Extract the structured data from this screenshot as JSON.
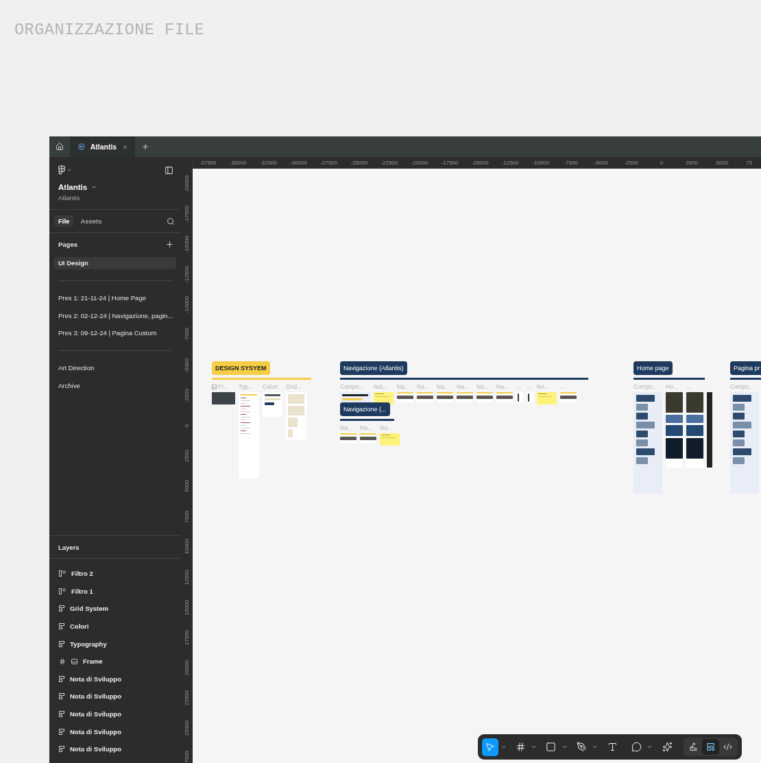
{
  "page_title": "ORGANIZZAZIONE FILE",
  "tabs": [
    {
      "label": "Atlantis",
      "selected": true
    }
  ],
  "sidebar": {
    "file_name": "Atlantis",
    "project": "Atlantis",
    "panel_tabs": [
      {
        "label": "File",
        "selected": true
      },
      {
        "label": "Assets",
        "selected": false
      }
    ],
    "pages_heading": "Pages",
    "page_groups": [
      {
        "items": [
          {
            "label": "UI Design",
            "selected": true
          }
        ]
      },
      {
        "items": [
          {
            "label": "Pres 1: 21-11-24 | Home Page",
            "selected": false
          },
          {
            "label": "Pres 2: 02-12-24 | Navigazione, pagin...",
            "selected": false
          },
          {
            "label": "Pres 3: 09-12-24 | Pagina Custom",
            "selected": false
          }
        ]
      },
      {
        "items": [
          {
            "label": "Art Direction",
            "selected": false
          },
          {
            "label": "Archive",
            "selected": false
          }
        ]
      }
    ],
    "layers_heading": "Layers",
    "layers": [
      {
        "name": "Filtro 2",
        "kind": "filter"
      },
      {
        "name": "Filtro 1",
        "kind": "filter"
      },
      {
        "name": "Grid System",
        "kind": "section"
      },
      {
        "name": "Colori",
        "kind": "section"
      },
      {
        "name": "Typography",
        "kind": "section"
      },
      {
        "name": "Frame",
        "kind": "frame"
      },
      {
        "name": "Nota di Sviluppo",
        "kind": "section"
      },
      {
        "name": "Nota di Sviluppo",
        "kind": "section"
      },
      {
        "name": "Nota di Sviluppo",
        "kind": "section"
      },
      {
        "name": "Nota di Sviluppo",
        "kind": "section"
      },
      {
        "name": "Nota di Sviluppo",
        "kind": "section"
      }
    ]
  },
  "rulers": {
    "horizontal": [
      "-37500",
      "-35000",
      "-32500",
      "-30000",
      "-27500",
      "-25000",
      "-22500",
      "-20000",
      "-17500",
      "-15000",
      "-12500",
      "-10000",
      "-7500",
      "-5000",
      "-2500",
      "0",
      "2500",
      "5000",
      "75"
    ],
    "vertical": [
      "-20000",
      "-17500",
      "-15000",
      "-12500",
      "-10000",
      "-7500",
      "-5000",
      "-2500",
      "0",
      "2500",
      "5000",
      "7500",
      "10000",
      "12500",
      "15000",
      "17500",
      "20000",
      "22500",
      "25000",
      "7500"
    ]
  },
  "canvas": {
    "sections": [
      {
        "label": "DESIGN SYSYEM",
        "color": "#f5cd47",
        "frames": [
          {
            "title": "Fr...",
            "kind": "photo"
          },
          {
            "title": "Typ...",
            "kind": "doc"
          },
          {
            "title": "Colori",
            "kind": "swatches"
          },
          {
            "title": "Grid...",
            "kind": "grid"
          }
        ]
      },
      {
        "label": "Navigazione (Atlantis)",
        "color": "#1e3a5f",
        "frames": [
          {
            "title": "Compo...",
            "kind": "component"
          },
          {
            "title": "Not...",
            "kind": "note"
          },
          {
            "title": "Na...",
            "kind": "screen"
          },
          {
            "title": "Na...",
            "kind": "screen"
          },
          {
            "title": "Na...",
            "kind": "screen"
          },
          {
            "title": "Na...",
            "kind": "screen"
          },
          {
            "title": "Na...",
            "kind": "screen"
          },
          {
            "title": "Na...",
            "kind": "screen"
          },
          {
            "title": "...",
            "kind": "mobile"
          },
          {
            "title": "...",
            "kind": "mobile"
          },
          {
            "title": "No...",
            "kind": "note"
          },
          {
            "title": "...",
            "kind": "screen"
          }
        ]
      },
      {
        "label": "Navigazione (...",
        "color": "#1e3a5f",
        "frames": [
          {
            "title": "Na...",
            "kind": "screen"
          },
          {
            "title": "Na...",
            "kind": "screen"
          },
          {
            "title": "No...",
            "kind": "note"
          }
        ]
      },
      {
        "label": "Home page",
        "color": "#1e3a5f",
        "frames": [
          {
            "title": "Compo...",
            "kind": "panel"
          },
          {
            "title": "Ho...",
            "kind": "page"
          },
          {
            "title": "...",
            "kind": "page"
          },
          {
            "kind": "strip"
          }
        ]
      },
      {
        "label": "Pagina pr",
        "color": "#1e3a5f",
        "frames": [
          {
            "title": "Compo...",
            "kind": "panel"
          }
        ]
      }
    ]
  },
  "toolbar": {
    "tools": [
      {
        "kind": "move",
        "selected": true,
        "menu": true
      },
      {
        "kind": "frame",
        "selected": false,
        "menu": true
      },
      {
        "kind": "shape",
        "selected": false,
        "menu": true
      },
      {
        "kind": "pen",
        "selected": false,
        "menu": true
      },
      {
        "kind": "text",
        "selected": false,
        "menu": false
      },
      {
        "kind": "comment",
        "selected": false,
        "menu": true
      },
      {
        "kind": "ai",
        "selected": false,
        "menu": false
      }
    ],
    "modes": [
      {
        "kind": "draw",
        "selected": false
      },
      {
        "kind": "design",
        "selected": true
      },
      {
        "kind": "code",
        "selected": false
      }
    ]
  }
}
